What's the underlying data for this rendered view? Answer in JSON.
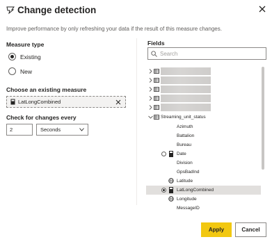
{
  "dialog": {
    "title": "Change detection",
    "description": "Improve performance by only refreshing your data if the result of this measure changes."
  },
  "measure_type": {
    "label": "Measure type",
    "options": [
      {
        "label": "Existing",
        "checked": true
      },
      {
        "label": "New",
        "checked": false
      }
    ]
  },
  "existing_measure": {
    "label": "Choose an existing measure",
    "value": "LatLongCombined"
  },
  "check_interval": {
    "label": "Check for changes every",
    "value": "2",
    "unit": "Seconds"
  },
  "fields": {
    "label": "Fields",
    "search_placeholder": "Search",
    "tables": [
      {
        "name": "",
        "expanded": false
      },
      {
        "name": "",
        "expanded": false
      },
      {
        "name": "",
        "expanded": false
      },
      {
        "name": "",
        "expanded": false
      },
      {
        "name": "",
        "expanded": false
      },
      {
        "name": "Streaming_unit_status",
        "expanded": true
      }
    ],
    "columns": [
      {
        "name": "Azimuth",
        "icon": "none"
      },
      {
        "name": "Battalion",
        "icon": "none"
      },
      {
        "name": "Bureau",
        "icon": "none"
      },
      {
        "name": "Date",
        "icon": "calculator-icon",
        "radio": true,
        "checked": false
      },
      {
        "name": "Division",
        "icon": "none"
      },
      {
        "name": "GpsBadInd",
        "icon": "none"
      },
      {
        "name": "Latitude",
        "icon": "globe-icon"
      },
      {
        "name": "LatLongCombined",
        "icon": "calculator-icon",
        "radio": true,
        "checked": true
      },
      {
        "name": "Longitude",
        "icon": "globe-icon"
      },
      {
        "name": "MessageID",
        "icon": "none"
      }
    ]
  },
  "buttons": {
    "apply": "Apply",
    "cancel": "Cancel"
  },
  "colors": {
    "primary": "#f2c811",
    "text": "#252423",
    "muted": "#605e5c",
    "border": "#8a8886",
    "selected_row": "#e1dfdd"
  }
}
